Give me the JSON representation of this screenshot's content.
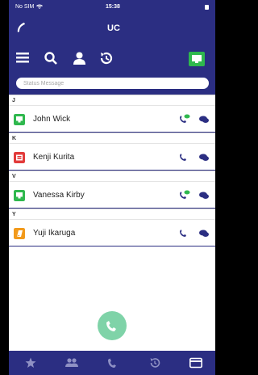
{
  "status_bar": {
    "carrier": "No SIM",
    "time": "15:38"
  },
  "header": {
    "title": "UC"
  },
  "status_message": {
    "placeholder": "Status Message",
    "value": ""
  },
  "toolbar": {
    "icons": [
      "menu-icon",
      "search-icon",
      "person-icon",
      "history-icon",
      "presence-monitor-icon"
    ]
  },
  "contacts": {
    "sections": [
      {
        "letter": "J",
        "contacts": [
          {
            "name": "John Wick",
            "avatar_color": "#2fb84e",
            "status": "available"
          }
        ]
      },
      {
        "letter": "K",
        "contacts": [
          {
            "name": "Kenji Kurita",
            "avatar_color": "#e23b3b",
            "status": "busy"
          }
        ]
      },
      {
        "letter": "V",
        "contacts": [
          {
            "name": "Vanessa Kirby",
            "avatar_color": "#2fb84e",
            "status": "available"
          }
        ]
      },
      {
        "letter": "Y",
        "contacts": [
          {
            "name": "Yuji Ikaruga",
            "avatar_color": "#f29a1b",
            "status": "away"
          }
        ]
      }
    ]
  },
  "bottom_nav": {
    "items": [
      "star-icon",
      "group-icon",
      "phone-icon",
      "history-icon",
      "card-icon"
    ]
  },
  "colors": {
    "accent": "#2b2e82",
    "fab": "#7fd3a8",
    "presence_green": "#2fb84e"
  }
}
